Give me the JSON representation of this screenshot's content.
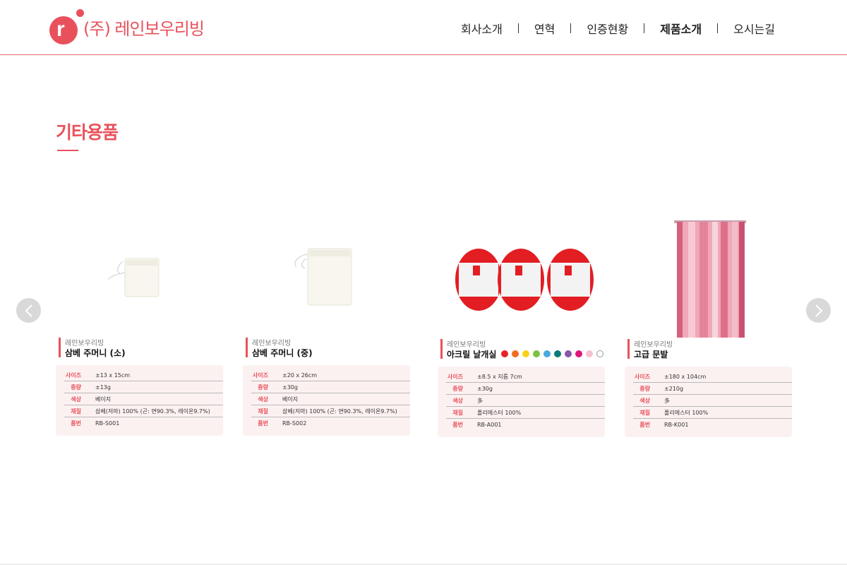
{
  "header": {
    "logo_mark": "r",
    "logo_text": "(주) 레인보우리빙",
    "brand_color": "#e8515b",
    "nav": [
      "회사소개",
      "연혁",
      "인증현황",
      "제품소개",
      "오시는길"
    ],
    "active_nav": "제품소개"
  },
  "section": {
    "title": "기타용품"
  },
  "carousel": {
    "prev_icon": "chevron-left-icon",
    "next_icon": "chevron-right-icon"
  },
  "spec_labels": [
    "사이즈",
    "중량",
    "색상",
    "재질",
    "품번"
  ],
  "products": [
    {
      "brand": "레인보우리빙",
      "name": "삼베 주머니 (소)",
      "specs": [
        "±13 x 15cm",
        "±13g",
        "베이지",
        "삼베(저마) 100% (곤: 면90.3%, 레이온9.7%)",
        "RB-S001"
      ]
    },
    {
      "brand": "레인보우리빙",
      "name": "삼베 주머니 (중)",
      "specs": [
        "±20 x 26cm",
        "±30g",
        "베이지",
        "삼베(저마) 100% (곤: 면90.3%, 레이온9.7%)",
        "RB-S002"
      ]
    },
    {
      "brand": "레인보우리빙",
      "name": "아크릴 날개실",
      "swatches": [
        "#e8202a",
        "#f26d21",
        "#f7d417",
        "#7cc242",
        "#4aa9de",
        "#0a7a78",
        "#8a56a8",
        "#e0157a",
        "#f6c1cf",
        "#ffffff"
      ],
      "specs": [
        "±8.5 x 지름 7cm",
        "±30g",
        "多",
        "폴리에스터 100%",
        "RB-A001"
      ]
    },
    {
      "brand": "레인보우리빙",
      "name": "고급 문발",
      "specs": [
        "±180 x 104cm",
        "±210g",
        "多",
        "폴리에스터 100%",
        "RB-K001"
      ]
    }
  ]
}
